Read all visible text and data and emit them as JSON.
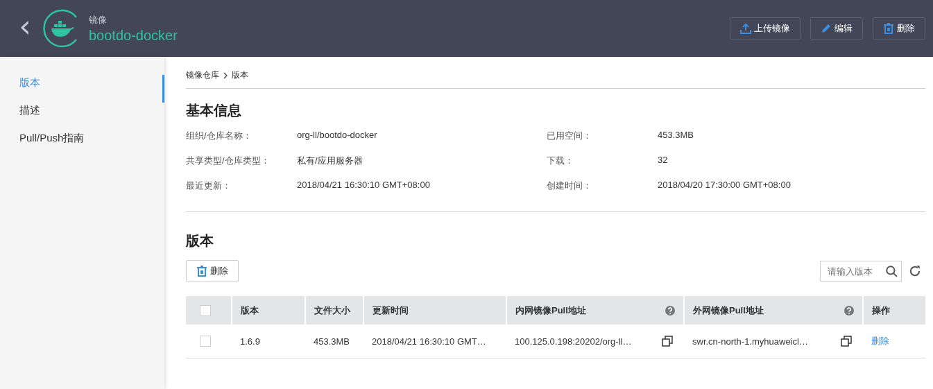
{
  "header": {
    "back": "‹",
    "subtitle": "镜像",
    "title": "bootdo-docker",
    "actions": [
      {
        "kind": "upload",
        "label": "上传镜像"
      },
      {
        "kind": "edit",
        "label": "编辑"
      },
      {
        "kind": "delete",
        "label": "删除"
      }
    ]
  },
  "sidebar": {
    "items": [
      {
        "label": "版本",
        "selected": true
      },
      {
        "label": "描述",
        "selected": false
      },
      {
        "label": "Pull/Push指南",
        "selected": false
      }
    ]
  },
  "breadcrumb": [
    "镜像仓库",
    "版本"
  ],
  "basic_info": {
    "title": "基本信息",
    "fields": [
      {
        "label": "组织/仓库名称：",
        "value": "org-ll/bootdo-docker"
      },
      {
        "label": "已用空间：",
        "value": "453.3MB"
      },
      {
        "label": "共享类型/仓库类型：",
        "value": "私有/应用服务器"
      },
      {
        "label": "下载：",
        "value": "32"
      },
      {
        "label": "最近更新：",
        "value": "2018/04/21 16:30:10 GMT+08:00"
      },
      {
        "label": "创建时间：",
        "value": "2018/04/20 17:30:00 GMT+08:00"
      }
    ]
  },
  "versions": {
    "title": "版本",
    "delete_button": "删除",
    "search": {
      "placeholder": "请输入版本"
    },
    "table": {
      "all_checked": false,
      "columns": [
        {
          "label": "版本",
          "help": false
        },
        {
          "label": "文件大小",
          "help": false
        },
        {
          "label": "更新时间",
          "help": false
        },
        {
          "label": "内网镜像Pull地址",
          "help": true
        },
        {
          "label": "外网镜像Pull地址",
          "help": true
        },
        {
          "label": "操作",
          "help": false
        }
      ],
      "rows": [
        {
          "checked": false,
          "version": "1.6.9",
          "size": "453.3MB",
          "updated": "2018/04/21 16:30:10 GMT…",
          "internal": "100.125.0.198:20202/org-ll…",
          "external": "swr.cn-north-1.myhuaweicl…",
          "action": "删除"
        }
      ]
    }
  }
}
